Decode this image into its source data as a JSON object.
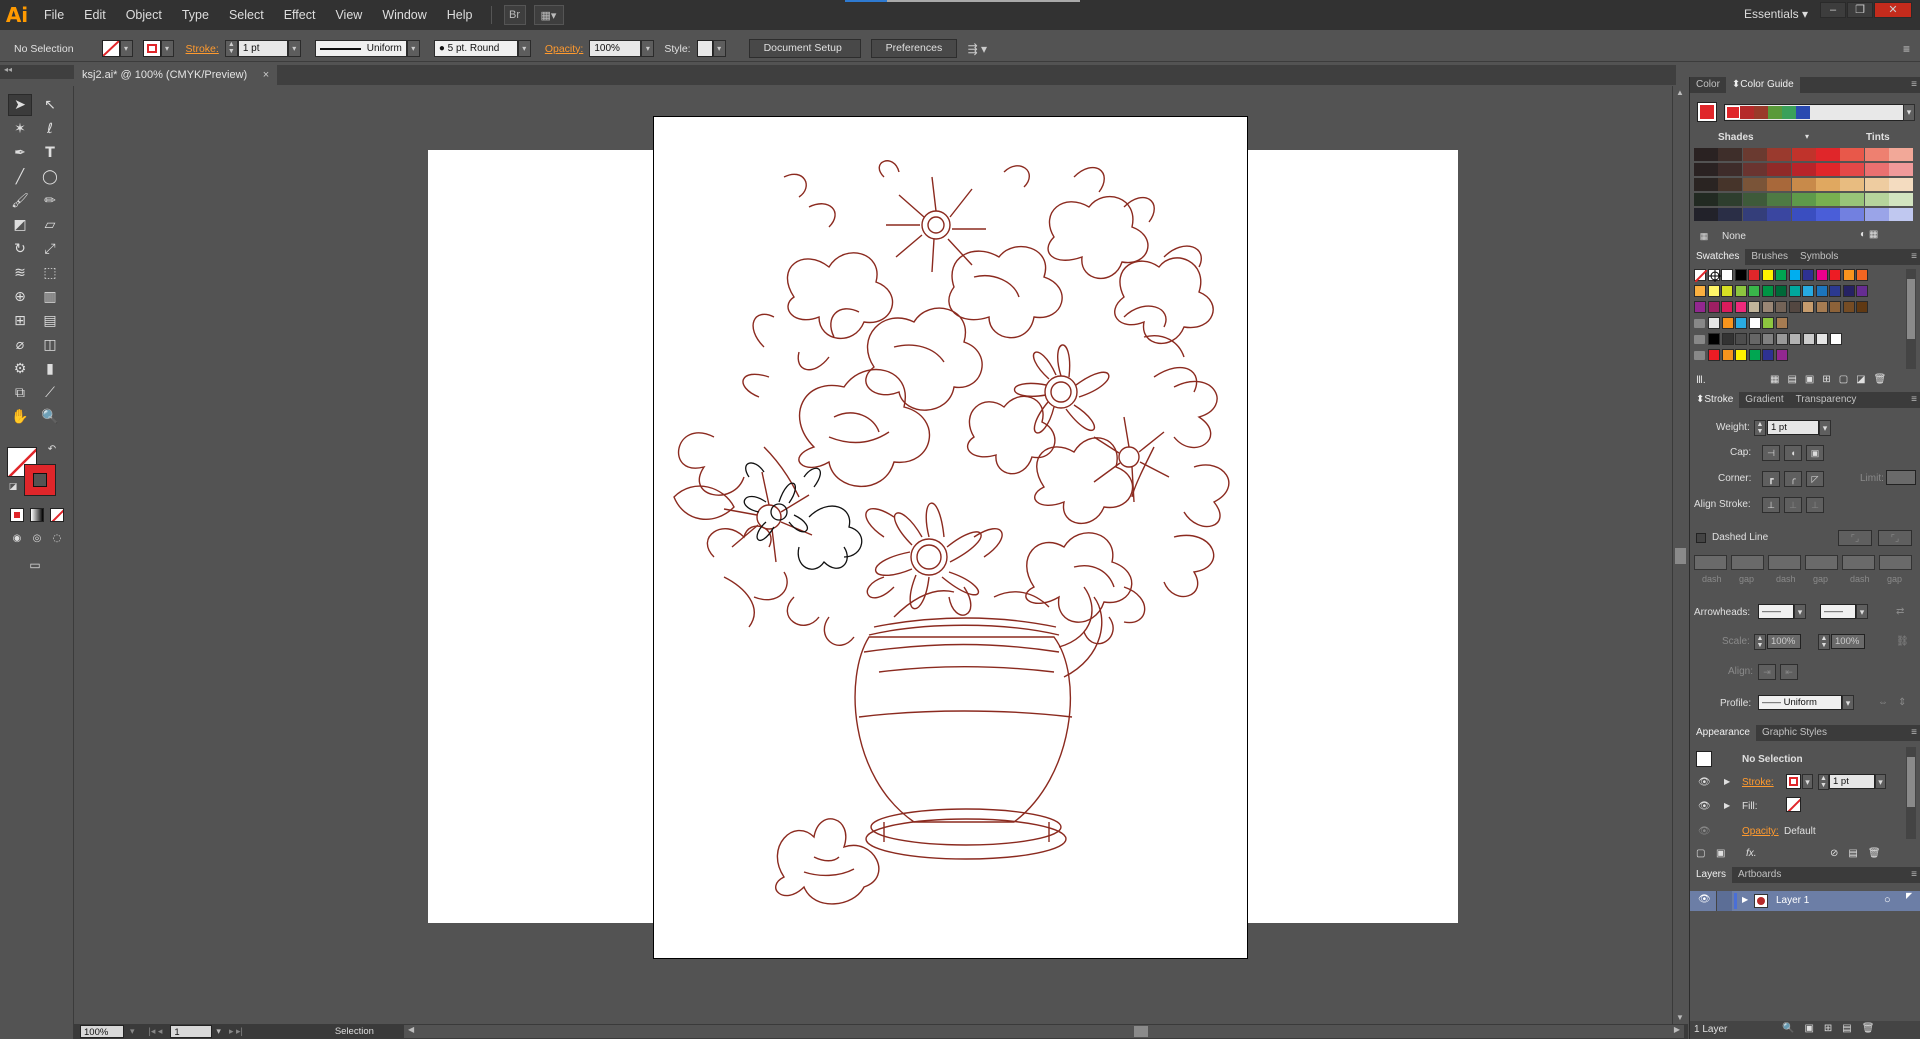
{
  "app": {
    "logo": "Ai",
    "menus": [
      "File",
      "Edit",
      "Object",
      "Type",
      "Select",
      "Effect",
      "View",
      "Window",
      "Help"
    ],
    "workspace": "Essentials"
  },
  "control_bar": {
    "selection": "No Selection",
    "stroke_label": "Stroke:",
    "stroke_weight": "1 pt",
    "profile": "Uniform",
    "brush": "5 pt. Round",
    "opacity_label": "Opacity:",
    "opacity": "100%",
    "style_label": "Style:",
    "doc_setup": "Document Setup",
    "preferences": "Preferences"
  },
  "document_tab": {
    "title": "ksj2.ai* @ 100% (CMYK/Preview)",
    "close": "×"
  },
  "status_bar": {
    "zoom": "100%",
    "artboard": "1",
    "tool": "Selection"
  },
  "panels": {
    "color_tabs": [
      "Color",
      "Color Guide"
    ],
    "shades_label": "Shades",
    "tints_label": "Tints",
    "none_label": "None",
    "swatch_tabs": [
      "Swatches",
      "Brushes",
      "Symbols"
    ],
    "stroke_tabs": [
      "Stroke",
      "Gradient",
      "Transparency"
    ],
    "stroke": {
      "weight_label": "Weight:",
      "weight": "1 pt",
      "cap_label": "Cap:",
      "corner_label": "Corner:",
      "limit_label": "Limit:",
      "align_label": "Align Stroke:",
      "dashed_label": "Dashed Line",
      "dash_labels": [
        "dash",
        "gap",
        "dash",
        "gap",
        "dash",
        "gap"
      ],
      "arrowheads_label": "Arrowheads:",
      "scale_label": "Scale:",
      "scale1": "100%",
      "scale2": "100%",
      "align2_label": "Align:",
      "profile_label": "Profile:",
      "profile": "Uniform"
    },
    "appearance_tabs": [
      "Appearance",
      "Graphic Styles"
    ],
    "appearance": {
      "title": "No Selection",
      "stroke_label": "Stroke:",
      "stroke_weight": "1 pt",
      "fill_label": "Fill:",
      "opacity_label": "Opacity:",
      "opacity_value": "Default",
      "fx": "fx."
    },
    "layers_tabs": [
      "Layers",
      "Artboards"
    ],
    "layer_name": "Layer 1",
    "layers_count": "1 Layer"
  },
  "colors": {
    "accent_red": "#e0262a",
    "stroke_brown": "#8b2a1f",
    "orange_label": "#ff9a2e"
  }
}
